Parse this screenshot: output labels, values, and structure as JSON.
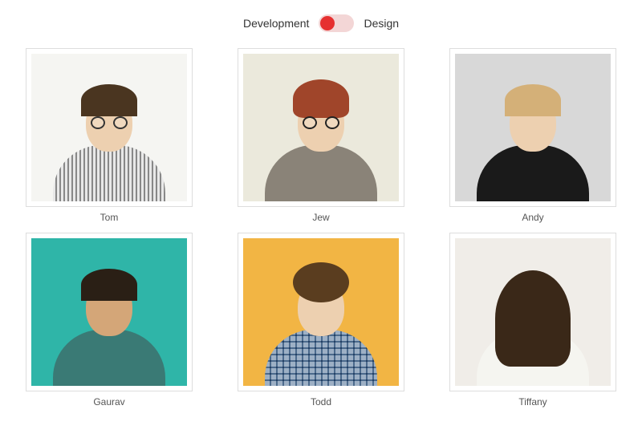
{
  "toggle": {
    "left_label": "Development",
    "right_label": "Design",
    "state": "left"
  },
  "team": [
    {
      "name": "Tom"
    },
    {
      "name": "Jew"
    },
    {
      "name": "Andy"
    },
    {
      "name": "Gaurav"
    },
    {
      "name": "Todd"
    },
    {
      "name": "Tiffany"
    }
  ]
}
